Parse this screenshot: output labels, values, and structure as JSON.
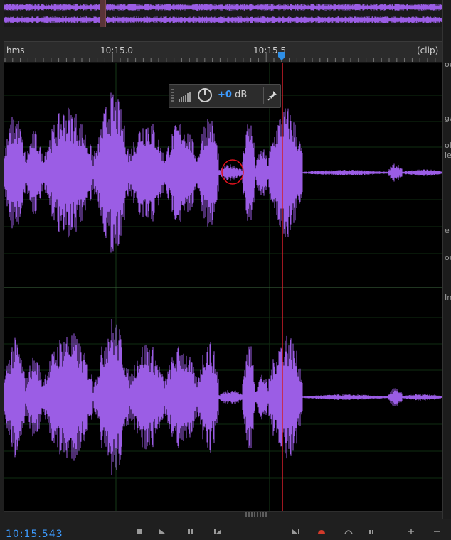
{
  "ruler": {
    "unit_label": "hms",
    "tick_1": "10:15.0",
    "tick_2": "10:15.5",
    "clip_label": "(clip)"
  },
  "hud": {
    "value_number": "+0",
    "value_unit": " dB"
  },
  "right_panel": {
    "fragments": [
      "ou",
      "ga",
      "ol",
      "ie",
      "e",
      "ou",
      "In"
    ]
  },
  "status": {
    "timecode": "10:15.543"
  },
  "colors": {
    "waveform": "#9b5de5",
    "playhead": "#d11f2a",
    "accent": "#3d9bff",
    "track_bg": "#000000",
    "gridline": "#0f3d13"
  },
  "icons": [
    "level-meter-icon",
    "gain-knob-icon",
    "pin-icon",
    "playhead-marker-icon",
    "record-icon",
    "play-icon",
    "stop-icon",
    "loop-icon",
    "skip-back-icon",
    "skip-forward-icon"
  ]
}
